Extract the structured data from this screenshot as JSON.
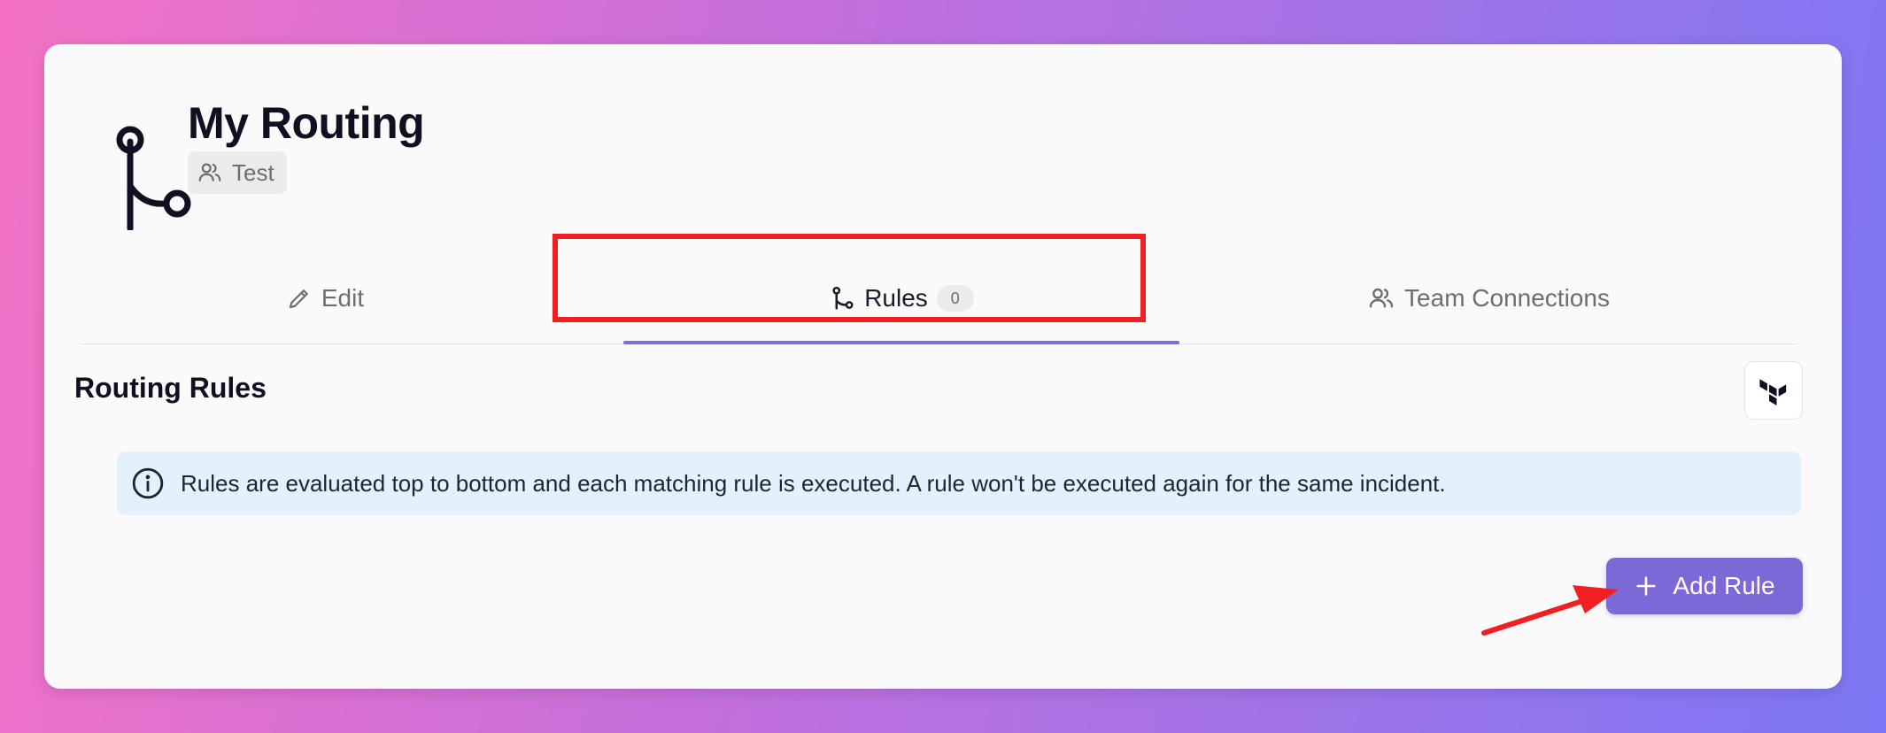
{
  "header": {
    "title": "My Routing",
    "team_badge": "Test",
    "icon": "routing-icon"
  },
  "tabs": [
    {
      "label": "Edit",
      "icon": "pencil-icon"
    },
    {
      "label": "Rules",
      "icon": "routing-icon",
      "count": "0",
      "active": true
    },
    {
      "label": "Team Connections",
      "icon": "users-icon"
    }
  ],
  "section": {
    "title": "Routing Rules",
    "terraform_icon": "terraform-icon"
  },
  "info": {
    "icon": "info-icon",
    "text": "Rules are evaluated top to bottom and each matching rule is executed. A rule won't be executed again for the same incident."
  },
  "add_button": {
    "label": "Add Rule",
    "icon": "plus-icon"
  },
  "colors": {
    "accent": "#7c68d6",
    "annotation_red": "#ef1f22",
    "info_bg": "#e3f1fc"
  }
}
